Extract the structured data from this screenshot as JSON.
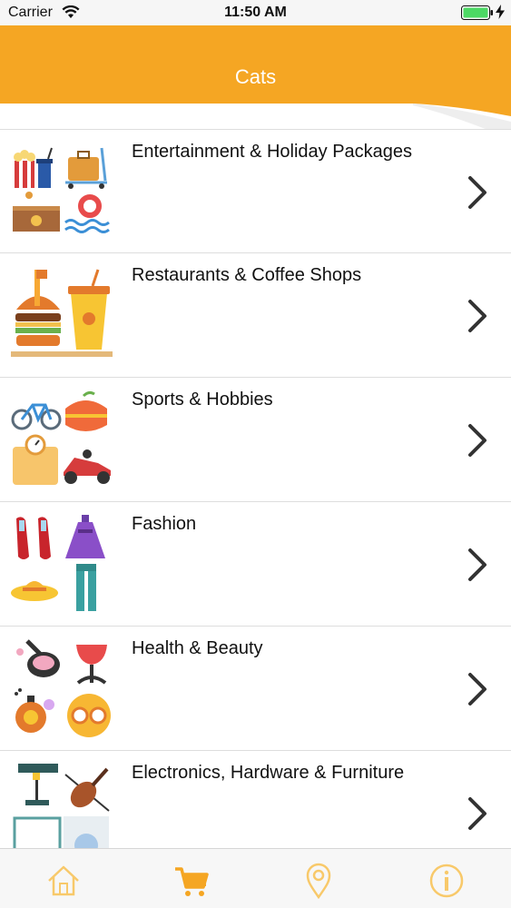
{
  "status_bar": {
    "carrier": "Carrier",
    "time": "11:50 AM",
    "battery_color": "#4cd964"
  },
  "header": {
    "title": "Cats",
    "accent_color": "#f5a623"
  },
  "categories": [
    {
      "label": "Entertainment & Holiday Packages",
      "icon": "entertainment-holiday-thumbnail"
    },
    {
      "label": "Restaurants & Coffee Shops",
      "icon": "restaurants-coffee-thumbnail"
    },
    {
      "label": "Sports & Hobbies",
      "icon": "sports-hobbies-thumbnail"
    },
    {
      "label": "Fashion",
      "icon": "fashion-thumbnail"
    },
    {
      "label": "Health & Beauty",
      "icon": "health-beauty-thumbnail"
    },
    {
      "label": "Electronics, Hardware & Furniture",
      "icon": "electronics-hardware-thumbnail"
    }
  ],
  "tab_bar": {
    "tabs": [
      {
        "icon": "home-icon",
        "active": false
      },
      {
        "icon": "cart-icon",
        "active": true
      },
      {
        "icon": "location-pin-icon",
        "active": false
      },
      {
        "icon": "info-icon",
        "active": false
      }
    ],
    "active_color": "#f5a623",
    "inactive_color": "#f8c96a"
  }
}
